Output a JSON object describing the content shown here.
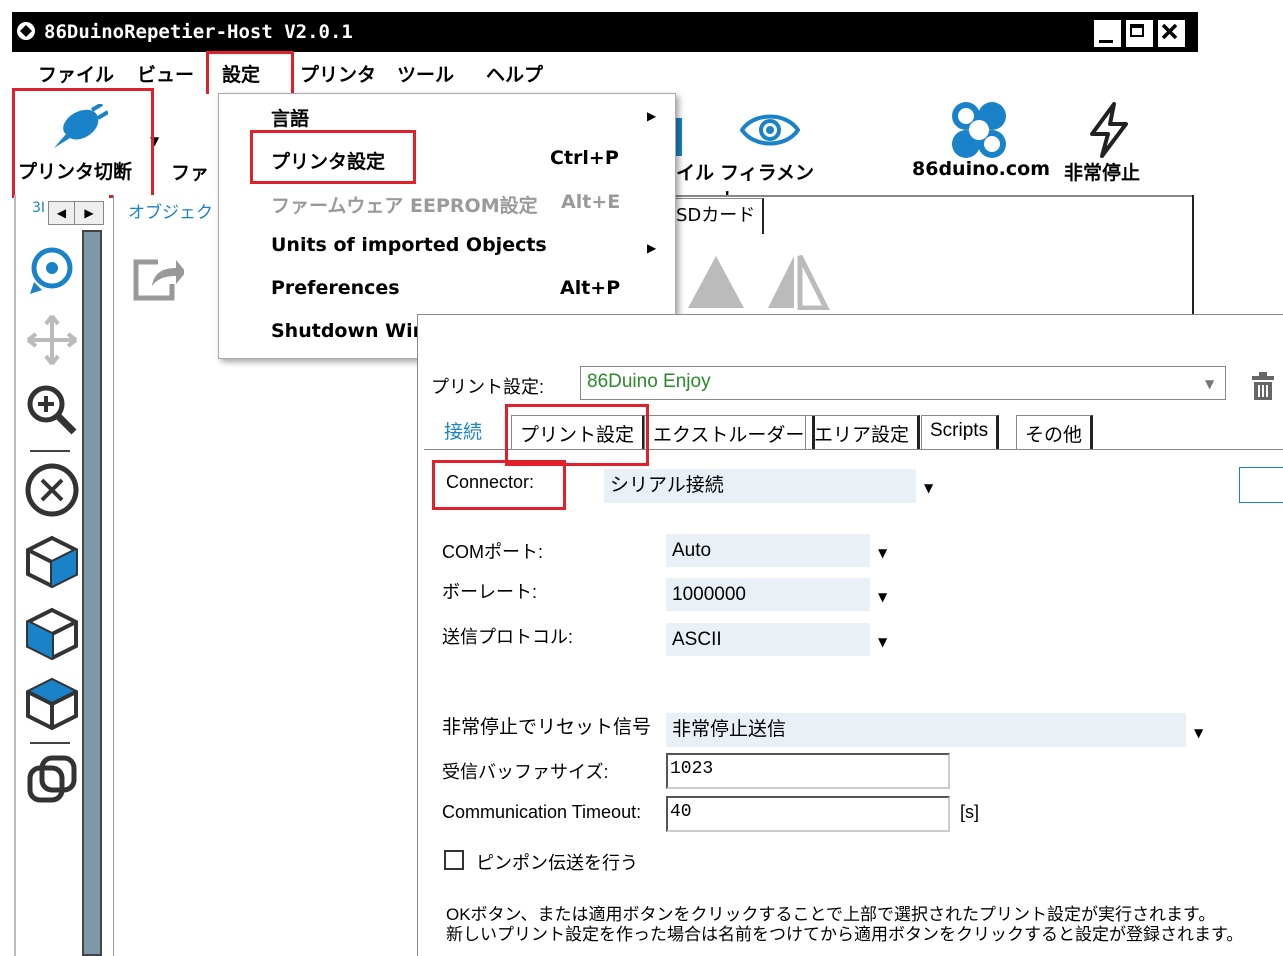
{
  "window": {
    "title": "86DuinoRepetier-Host V2.0.1"
  },
  "menubar": {
    "items": [
      "ファイル",
      "ビュー",
      "設定",
      "プリンタ",
      "ツール",
      "ヘルプ"
    ]
  },
  "toolbar": {
    "disconnect_label": "プリンタ切断",
    "file_label_partial": "ファ",
    "filename_partial": "イル",
    "filament_label": "フィラメント",
    "site_label": "86duino.com",
    "estop_label": "非常停止"
  },
  "left_panel": {
    "tab_partial": "3I",
    "objects_partial": "オブジェク"
  },
  "right_panel": {
    "sd_tab": "SDカード"
  },
  "dropdown": {
    "items": [
      {
        "label": "言語",
        "shortcut": "",
        "submenu": true,
        "disabled": false
      },
      {
        "label": "プリンタ設定",
        "shortcut": "Ctrl+P",
        "submenu": false,
        "disabled": false
      },
      {
        "label": "ファームウェア EEPROM設定",
        "shortcut": "Alt+E",
        "submenu": false,
        "disabled": true
      },
      {
        "label": "Units of imported Objects",
        "shortcut": "",
        "submenu": true,
        "disabled": false
      },
      {
        "label": "Preferences",
        "shortcut": "Alt+P",
        "submenu": false,
        "disabled": false
      },
      {
        "label": "Shutdown Windows after print",
        "shortcut": "",
        "submenu": false,
        "disabled": false
      }
    ]
  },
  "dialog": {
    "profile_label": "プリント設定:",
    "profile_value": "86Duino Enjoy",
    "tabs": [
      "接続",
      "プリント設定",
      "エクストルーダー",
      "エリア設定",
      "Scripts",
      "その他"
    ],
    "active_tab": "接続",
    "connector_label": "Connector:",
    "connector_value": "シリアル接続",
    "com_label": "COMポート:",
    "com_value": "Auto",
    "baud_label": "ボーレート:",
    "baud_value": "1000000",
    "protocol_label": "送信プロトコル:",
    "protocol_value": "ASCII",
    "reset_label": "非常停止でリセット信号",
    "reset_value": "非常停止送信",
    "buffer_label": "受信バッファサイズ:",
    "buffer_value": "1023",
    "timeout_label": "Communication Timeout:",
    "timeout_value": "40",
    "timeout_unit": "[s]",
    "pingpong_label": "ピンポン伝送を行う",
    "pingpong_checked": false,
    "note_line1": "OKボタン、または適用ボタンをクリックすることで上部で選択されたプリント設定が実行されます。",
    "note_line2": "新しいプリント設定を作った場合は名前をつけてから適用ボタンをクリックすると設定が登録されます。"
  },
  "colors": {
    "highlight": "#e0202a",
    "accent_blue": "#1a82c8",
    "profile_green": "#2b8a2b",
    "select_bg": "#eaf1f6"
  }
}
